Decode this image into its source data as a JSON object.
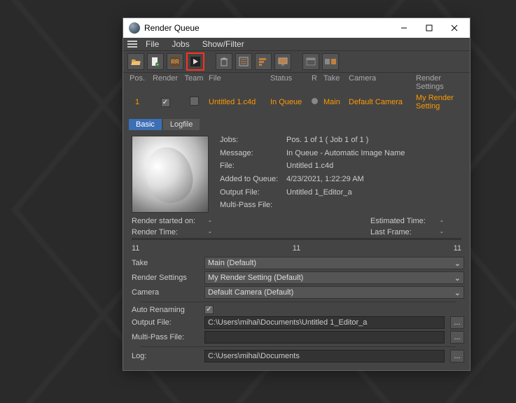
{
  "window": {
    "title": "Render Queue"
  },
  "menubar": {
    "file": "File",
    "jobs": "Jobs",
    "showfilter": "Show/Filter"
  },
  "toolbar": {
    "open_icon": "folder-open-icon",
    "new_icon": "new-doc-icon",
    "rr_icon": "rr-icon",
    "play_icon": "play-icon",
    "delete_icon": "trash-icon",
    "list_icon": "list-icon",
    "sort_icon": "sort-icon",
    "monitor_icon": "monitor-icon",
    "prefs_icon": "window-icon",
    "compare_icon": "compare-icon"
  },
  "columns": {
    "pos": "Pos.",
    "render": "Render",
    "team": "Team",
    "file": "File",
    "status": "Status",
    "r": "R",
    "take": "Take",
    "camera": "Camera",
    "rs": "Render Settings"
  },
  "row": {
    "pos": "1",
    "file": "Untitled 1.c4d",
    "status": "In Queue",
    "take": "Main",
    "camera": "Default Camera",
    "rs": "My Render Setting"
  },
  "tabs": {
    "basic": "Basic",
    "logfile": "Logfile"
  },
  "info": {
    "jobs_label": "Jobs:",
    "jobs_value": "Pos. 1 of 1 ( Job 1 of 1 )",
    "message_label": "Message:",
    "message_value": "In Queue - Automatic Image Name",
    "file_label": "File:",
    "file_value": "Untitled 1.c4d",
    "added_label": "Added to Queue:",
    "added_value": "4/23/2021, 1:22:29 AM",
    "output_label": "Output File:",
    "output_value": "Untitled 1_Editor_a",
    "multipass_label": "Multi-Pass File:",
    "multipass_value": ""
  },
  "timing": {
    "render_started_label": "Render started on:",
    "render_started_value": "-",
    "render_time_label": "Render Time:",
    "render_time_value": "-",
    "estimated_label": "Estimated Time:",
    "estimated_value": "-",
    "lastframe_label": "Last Frame:",
    "lastframe_value": "-"
  },
  "progress": {
    "left": "11",
    "center": "11",
    "right": "11"
  },
  "form": {
    "take_label": "Take",
    "take_value": "Main (Default)",
    "rs_label": "Render Settings",
    "rs_value": "My Render Setting (Default)",
    "camera_label": "Camera",
    "camera_value": "Default Camera (Default)",
    "auto_label": "Auto Renaming",
    "output_label": "Output File:",
    "output_value": "C:\\Users\\mihai\\Documents\\Untitled 1_Editor_a",
    "multipass_label": "Multi-Pass File:",
    "multipass_value": "",
    "log_label": "Log:",
    "log_value": "C:\\Users\\mihai\\Documents",
    "browse": "..."
  }
}
